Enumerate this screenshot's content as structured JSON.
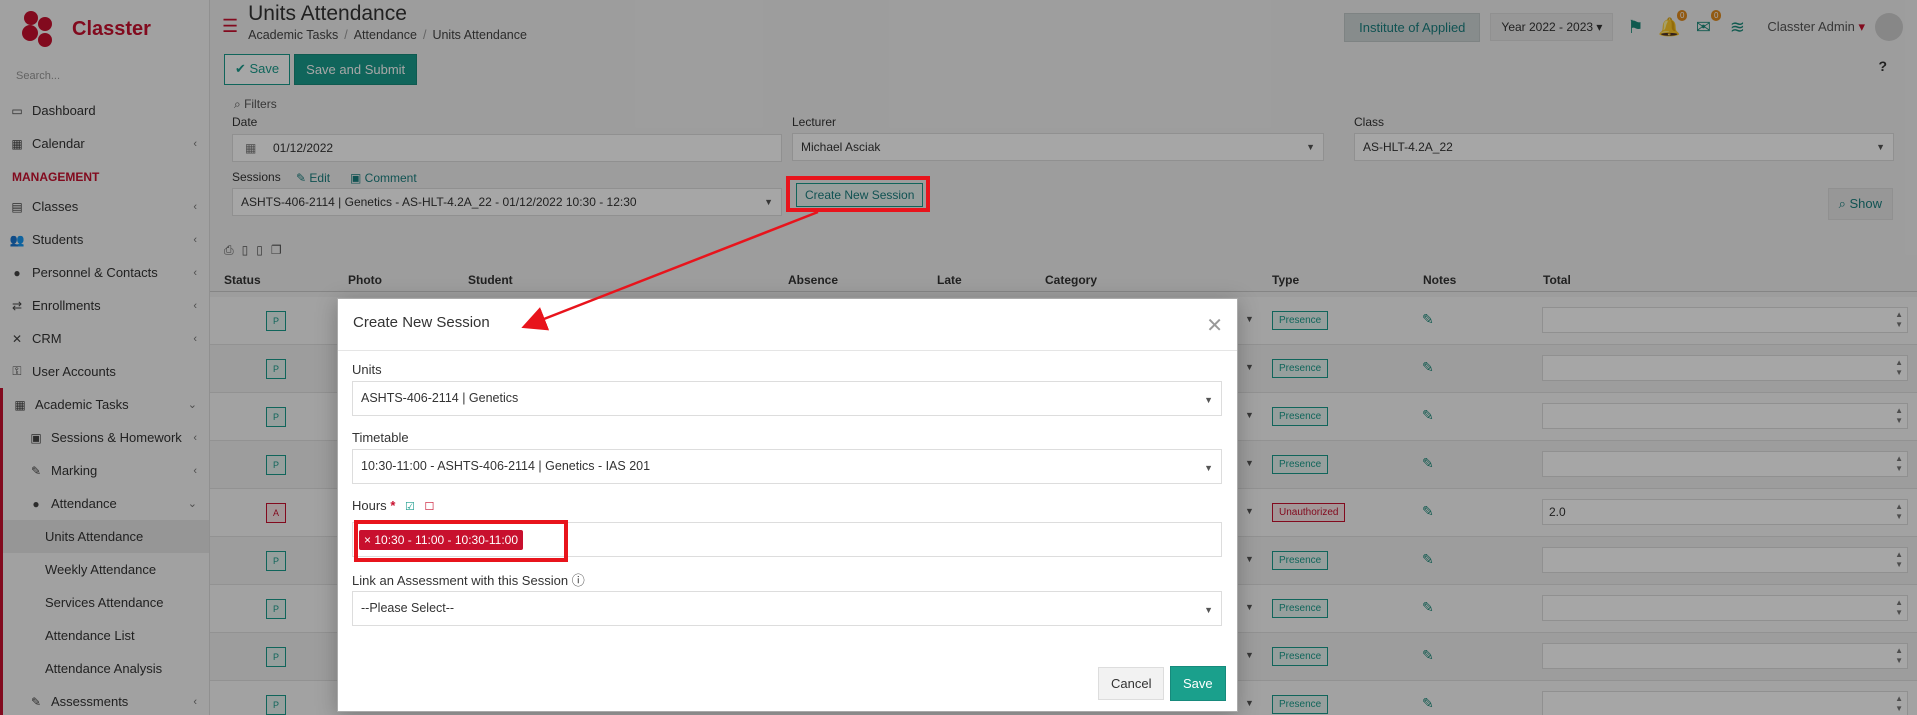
{
  "app": {
    "name": "Classter"
  },
  "sidebar": {
    "search_placeholder": "Search...",
    "items": [
      {
        "label": "Dashboard",
        "icon": "monitor-icon"
      },
      {
        "label": "Calendar",
        "icon": "calendar-icon"
      }
    ],
    "section": "MANAGEMENT",
    "mgmt_items": [
      {
        "label": "Classes"
      },
      {
        "label": "Students"
      },
      {
        "label": "Personnel & Contacts"
      },
      {
        "label": "Enrollments"
      },
      {
        "label": "CRM"
      },
      {
        "label": "User Accounts"
      }
    ],
    "academic": "Academic Tasks",
    "academic_items": [
      {
        "label": "Sessions & Homework"
      },
      {
        "label": "Marking"
      },
      {
        "label": "Attendance"
      }
    ],
    "attendance_items": [
      {
        "label": "Units Attendance"
      },
      {
        "label": "Weekly Attendance"
      },
      {
        "label": "Services Attendance"
      },
      {
        "label": "Attendance List"
      },
      {
        "label": "Attendance Analysis"
      }
    ],
    "assessments": "Assessments"
  },
  "header": {
    "title": "Units Attendance",
    "breadcrumb": [
      "Academic Tasks",
      "Attendance",
      "Units Attendance"
    ],
    "institute": "Institute of Applied",
    "year": "Year 2022 - 2023",
    "badges": [
      "0",
      "0"
    ],
    "user": "Classter Admin"
  },
  "toolbar": {
    "save": "Save",
    "save_submit": "Save and Submit",
    "help": "?"
  },
  "filters": {
    "title": "Filters",
    "date_label": "Date",
    "date_value": "01/12/2022",
    "lecturer_label": "Lecturer",
    "lecturer_value": "Michael Asciak",
    "class_label": "Class",
    "class_value": "AS-HLT-4.2A_22",
    "sessions_label": "Sessions",
    "edit": "Edit",
    "comment": "Comment",
    "session_value": "ASHTS-406-2114 | Genetics - AS-HLT-4.2A_22 - 01/12/2022 10:30 - 12:30",
    "create_session": "Create New Session",
    "show": "Show"
  },
  "table": {
    "headers": [
      "Status",
      "Photo",
      "Student",
      "Absence",
      "Late",
      "Category",
      "Type",
      "Notes",
      "Total"
    ],
    "rows": [
      {
        "status": "P",
        "type": "Presence",
        "total": ""
      },
      {
        "status": "P",
        "type": "Presence",
        "total": ""
      },
      {
        "status": "P",
        "type": "Presence",
        "total": ""
      },
      {
        "status": "P",
        "type": "Presence",
        "total": ""
      },
      {
        "status": "A",
        "type": "Unauthorized",
        "total": "2.0"
      },
      {
        "status": "P",
        "type": "Presence",
        "total": ""
      },
      {
        "status": "P",
        "type": "Presence",
        "total": ""
      },
      {
        "status": "P",
        "type": "Presence",
        "total": ""
      },
      {
        "status": "P",
        "type": "Presence",
        "total": ""
      }
    ]
  },
  "modal": {
    "title": "Create New Session",
    "units_label": "Units",
    "units_value": "ASHTS-406-2114 | Genetics",
    "timetable_label": "Timetable",
    "timetable_value": "10:30-11:00 - ASHTS-406-2114 | Genetics - IAS 201",
    "hours_label": "Hours",
    "required": "*",
    "hours_tag": "10:30 - 11:00 - 10:30-11:00",
    "assessment_label": "Link an Assessment with this Session",
    "assessment_value": "--Please Select--",
    "cancel": "Cancel",
    "save": "Save"
  },
  "colors": {
    "brand": "#c8102e",
    "accent": "#1a9c8c",
    "annotation": "#e8141c"
  }
}
